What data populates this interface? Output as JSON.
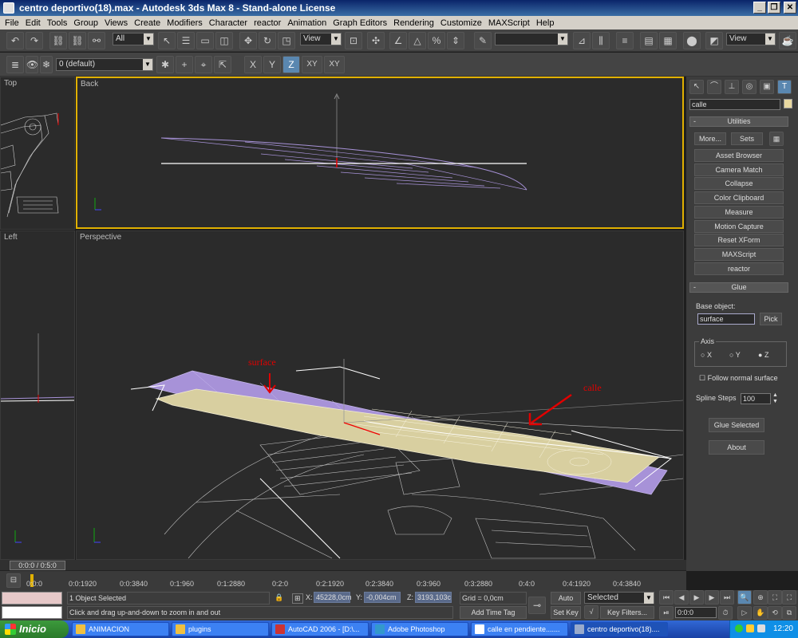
{
  "window": {
    "title": "centro deportivo(18).max - Autodesk 3ds Max 8  - Stand-alone License"
  },
  "menu": [
    "File",
    "Edit",
    "Tools",
    "Group",
    "Views",
    "Create",
    "Modifiers",
    "Character",
    "reactor",
    "Animation",
    "Graph Editors",
    "Rendering",
    "Customize",
    "MAXScript",
    "Help"
  ],
  "toolbar": {
    "selection_filter": "All",
    "ref_coord": "View",
    "named_sel": "",
    "view2": "View"
  },
  "layer_bar": {
    "layer": "0 (default)",
    "axis_x": "X",
    "axis_y": "Y",
    "axis_z": "Z",
    "axis_xy": "XY",
    "axis_xy2": "XY"
  },
  "viewports": {
    "top": "Top",
    "back": "Back",
    "left": "Left",
    "perspective": "Perspective"
  },
  "annotations": {
    "surface": "surface",
    "calle": "calle"
  },
  "command_panel": {
    "object_name": "calle",
    "utilities_title": "Utilities",
    "more": "More...",
    "sets": "Sets",
    "utilities": [
      "Asset Browser",
      "Camera Match",
      "Collapse",
      "Color Clipboard",
      "Measure",
      "Motion Capture",
      "Reset XForm",
      "MAXScript",
      "reactor"
    ],
    "glue_title": "Glue",
    "base_object_label": "Base object:",
    "base_object_value": "surface",
    "pick": "Pick",
    "axis_label": "Axis",
    "axis_x": "X",
    "axis_y": "Y",
    "axis_z": "Z",
    "follow_normal": "Follow normal surface",
    "spline_steps_label": "Spline Steps",
    "spline_steps_value": "100",
    "glue_selected": "Glue Selected",
    "about": "About"
  },
  "timeline": {
    "slider": "0:0:0 / 0:5:0",
    "ticks": [
      "0:0:0",
      "0:0:1920",
      "0:0:3840",
      "0:1:960",
      "0:1:2880",
      "0:2:0",
      "0:2:1920",
      "0:2:3840",
      "0:3:960",
      "0:3:2880",
      "0:4:0",
      "0:4:1920",
      "0:4:3840"
    ]
  },
  "status": {
    "selected": "1 Object Selected",
    "prompt": "Click and drag up-and-down to zoom in and out",
    "x_label": "X:",
    "x": "45228,0cm",
    "y_label": "Y:",
    "y": "-0,004cm",
    "z_label": "Z:",
    "z": "3193,103c",
    "grid": "Grid = 0,0cm",
    "add_time_tag": "Add Time Tag",
    "auto_key": "Auto Key",
    "selected_mode": "Selected",
    "set_key": "Set Key",
    "key_filters": "Key Filters...",
    "frame": "0:0:0"
  },
  "taskbar": {
    "start": "Inicio",
    "tasks": [
      "ANIMACION",
      "plugins",
      "AutoCAD 2006 - [D:\\...",
      "Adobe Photoshop",
      "calle en pendiente.......",
      "centro deportivo(18)...."
    ],
    "clock": "12:20"
  },
  "colors": {
    "surface_purple": "#a792d8",
    "calle_tan": "#d8cfa0",
    "active_border": "#e0b000",
    "annotation_red": "#e00000"
  }
}
